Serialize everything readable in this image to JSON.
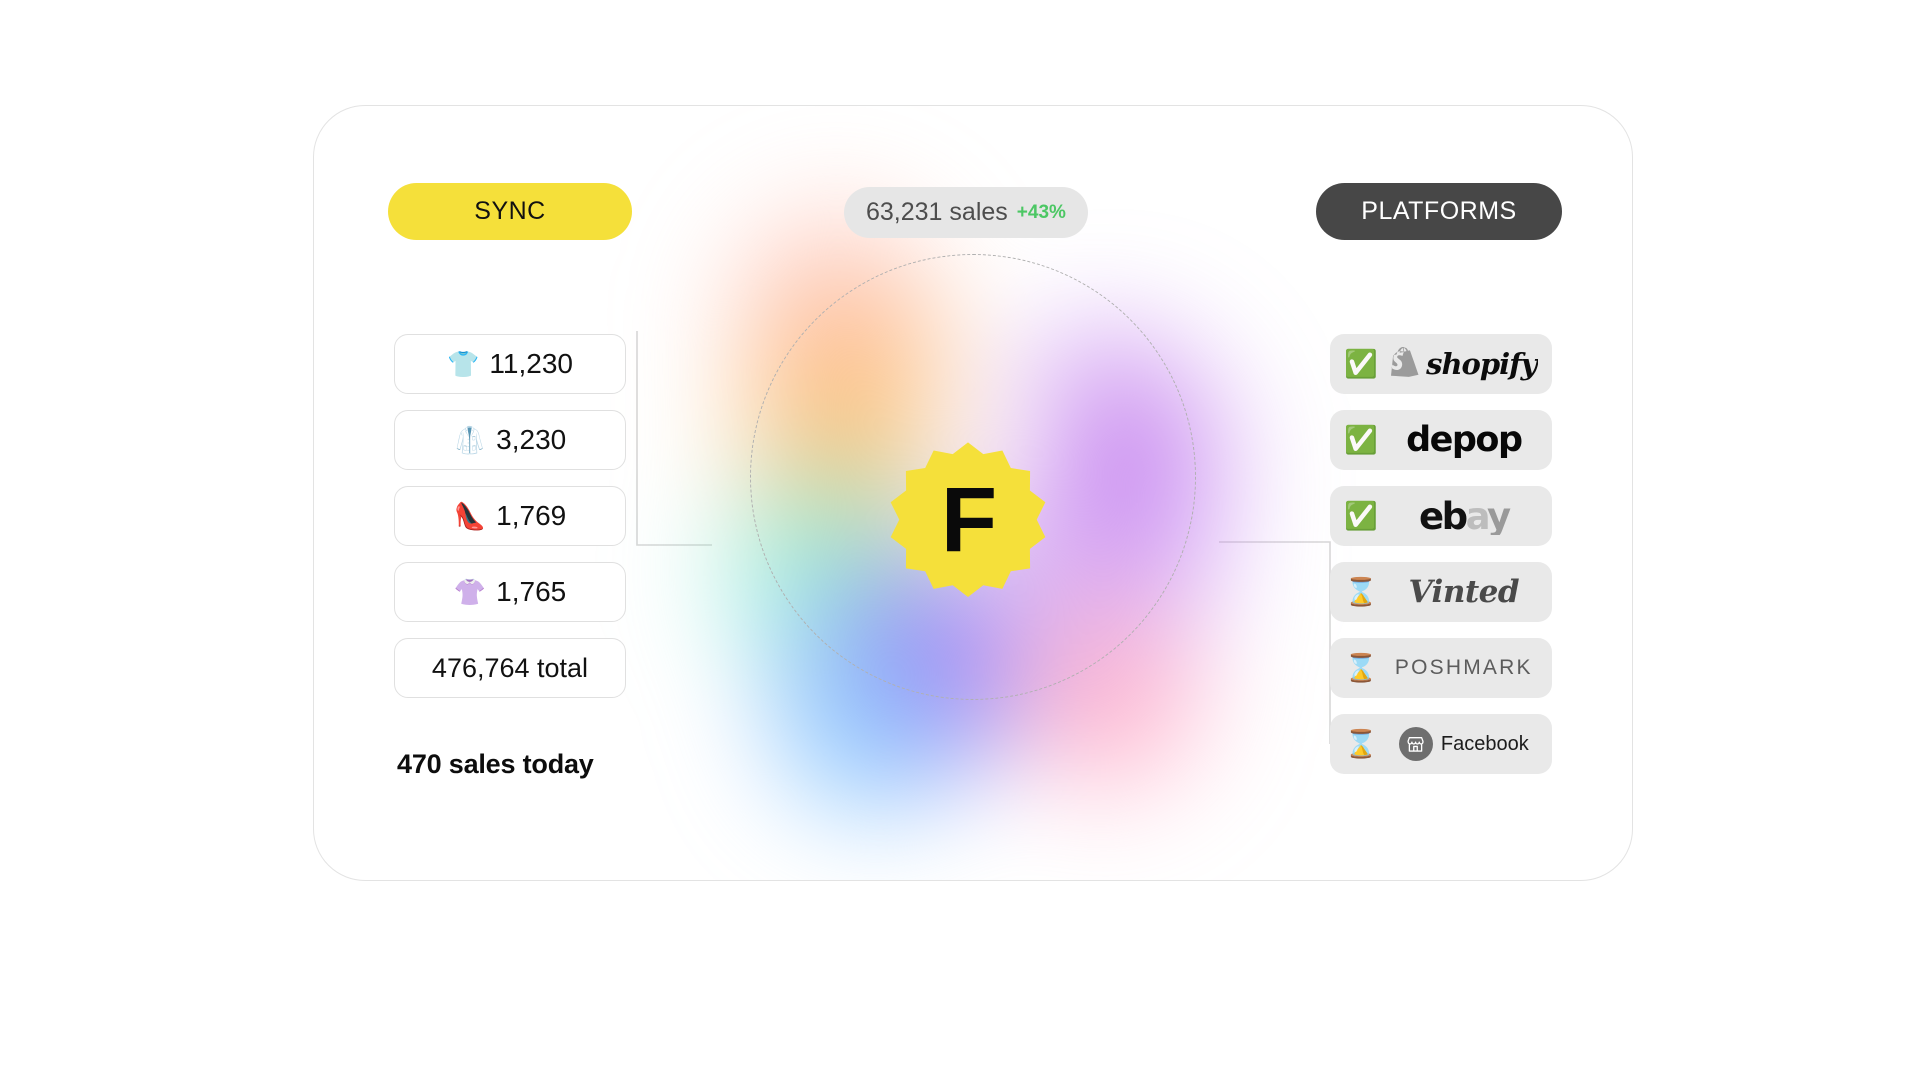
{
  "card": {
    "sync_button": "SYNC",
    "platforms_button": "PLATFORMS"
  },
  "sales_badge": {
    "count": "63,231 sales",
    "delta": "+43%",
    "delta_color": "#4cc764"
  },
  "center_badge": {
    "letter": "F",
    "badge_color": "#f5e03a"
  },
  "stats": {
    "items": [
      {
        "icon": "tshirt-icon",
        "emoji": "👕",
        "value": "11,230"
      },
      {
        "icon": "coat-icon",
        "emoji": "🥼",
        "value": "3,230"
      },
      {
        "icon": "high-heel-icon",
        "emoji": "👠",
        "value": "1,769"
      },
      {
        "icon": "blouse-icon",
        "emoji": "👚",
        "value": "1,765"
      }
    ],
    "total": "476,764 total",
    "sales_today": "470 sales today"
  },
  "platforms": {
    "items": [
      {
        "status_icon": "check-mark-icon",
        "status": "✅",
        "name": "shopify",
        "synced": true
      },
      {
        "status_icon": "check-mark-icon",
        "status": "✅",
        "name": "depop",
        "synced": true
      },
      {
        "status_icon": "check-mark-icon",
        "status": "✅",
        "name": "ebay",
        "synced": true
      },
      {
        "status_icon": "hourglass-icon",
        "status": "⌛",
        "name": "Vinted",
        "synced": false
      },
      {
        "status_icon": "hourglass-icon",
        "status": "⌛",
        "name": "POSHMARK",
        "synced": false
      },
      {
        "status_icon": "hourglass-icon",
        "status": "⌛",
        "name": "Facebook",
        "synced": false
      }
    ],
    "ebay_parts": {
      "e": "e",
      "b": "b",
      "a": "a",
      "y": "y"
    }
  },
  "theme": {
    "yellow": "#f5e03a",
    "dark": "#474747",
    "green": "#4cc764",
    "chip_gray": "#e9e9e9"
  }
}
